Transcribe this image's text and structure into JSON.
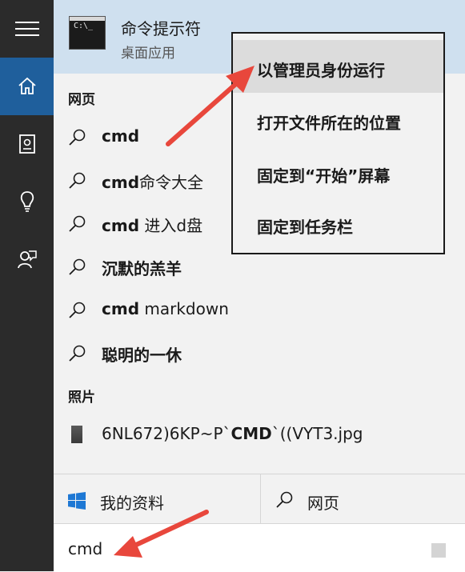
{
  "best_match": {
    "title": "命令提示符",
    "subtitle": "桌面应用",
    "icon_text": "C:\\_"
  },
  "sections": {
    "web": "网页",
    "photos": "照片"
  },
  "web_results": [
    {
      "bold": "cmd",
      "rest": ""
    },
    {
      "bold": "cmd",
      "rest": "命令大全"
    },
    {
      "bold": "cmd",
      "rest": " 进入d盘"
    },
    {
      "bold": "沉默的羔羊",
      "rest": ""
    },
    {
      "bold": "cmd",
      "rest": " markdown"
    },
    {
      "bold": "聪明的一休",
      "rest": ""
    }
  ],
  "photo_result": {
    "pre": "6NL672)6KP~P`",
    "bold": "CMD",
    "post": "`((VYT3.jpg"
  },
  "bottom_tabs": {
    "my_stuff": "我的资料",
    "web": "网页"
  },
  "search_box": {
    "value": "cmd"
  },
  "context_menu": [
    "以管理员身份运行",
    "打开文件所在的位置",
    "固定到“开始”屏幕",
    "固定到任务栏"
  ],
  "colors": {
    "sidebar": "#2b2b2b",
    "sidebar_active": "#1f5f9c",
    "best_match_bg": "#cfe0ef",
    "arrow": "#e8473c"
  },
  "icons": {
    "sidebar": [
      "hamburger-menu-icon",
      "home-icon",
      "notebook-icon",
      "lightbulb-icon",
      "feedback-icon"
    ]
  }
}
